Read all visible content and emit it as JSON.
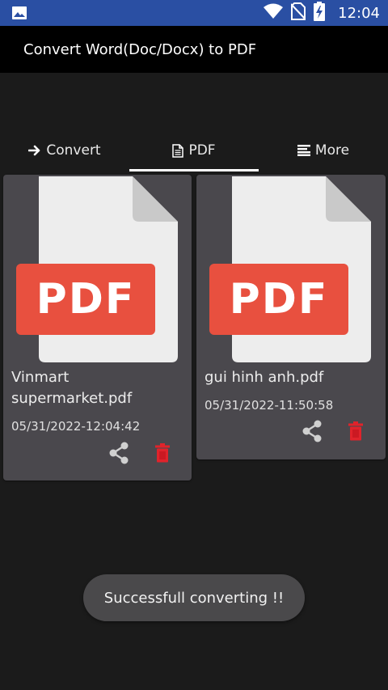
{
  "status_bar": {
    "time": "12:04",
    "icons": [
      "image-icon",
      "wifi-icon",
      "no-sim-icon",
      "battery-charging-icon"
    ]
  },
  "app_bar": {
    "title": "Convert Word(Doc/Docx) to PDF"
  },
  "tabs": [
    {
      "label": "Convert",
      "icon": "arrow-right-icon",
      "active": false
    },
    {
      "label": "PDF",
      "icon": "document-icon",
      "active": true
    },
    {
      "label": "More",
      "icon": "menu-lines-icon",
      "active": false
    }
  ],
  "files": [
    {
      "thumb_label": "PDF",
      "name": "Vinmart supermarket.pdf",
      "date": "05/31/2022-12:04:42"
    },
    {
      "thumb_label": "PDF",
      "name": "gui hinh anh.pdf",
      "date": "05/31/2022-11:50:58"
    }
  ],
  "toast": {
    "message": "Successfull converting !!"
  },
  "colors": {
    "status_bar": "#2a4fa3",
    "app_bar": "#000000",
    "background": "#1b1b1b",
    "card": "#4a484d",
    "pdf_badge": "#e8503f",
    "delete": "#e0232b"
  }
}
